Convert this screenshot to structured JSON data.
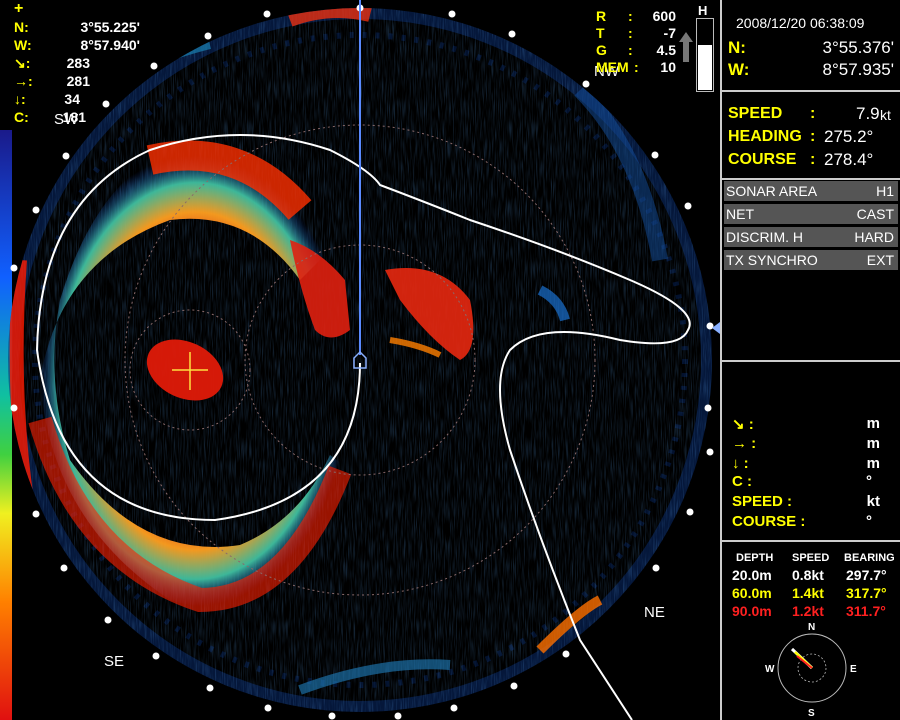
{
  "colors": {
    "accent": "#ffff00",
    "value": "#ffffff",
    "alert": "#ff2020",
    "button_bg": "#555555",
    "ring": "#ffffff"
  },
  "top_left": {
    "cursor_icon": "plus-icon",
    "rows": [
      {
        "key": "N:",
        "value": "3°55.225'"
      },
      {
        "key": "W:",
        "value": "8°57.940'"
      },
      {
        "key": "↘:",
        "value": "283"
      },
      {
        "key": "→:",
        "value": "281"
      },
      {
        "key": "↓:",
        "value": "34"
      },
      {
        "key": "C:",
        "value": "181"
      }
    ]
  },
  "top_mid": {
    "rows": [
      {
        "key": "R",
        "value": "600"
      },
      {
        "key": "T",
        "value": "-7"
      },
      {
        "key": "G",
        "value": "4.5"
      },
      {
        "key": "MEM",
        "value": "10"
      }
    ],
    "gain_label": "H",
    "gain_level": 0.62
  },
  "sonar": {
    "direction_labels": [
      "SW",
      "NW",
      "NE",
      "SE"
    ]
  },
  "panel": {
    "datetime": "2008/12/20 06:38:09",
    "lat_key": "N:",
    "lat": "3°55.376'",
    "lon_key": "W:",
    "lon": "8°57.935'",
    "speed_key": "SPEED",
    "speed": "7.9",
    "speed_unit": "kt",
    "heading_key": "HEADING",
    "heading": "275.2°",
    "course_key": "COURSE",
    "course": "278.4°",
    "colon": ":",
    "settings": [
      {
        "label": "SONAR AREA",
        "value": "H1"
      },
      {
        "label": "NET",
        "value": "CAST"
      },
      {
        "label": "DISCRIM. H",
        "value": "HARD"
      },
      {
        "label": "TX SYNCHRO",
        "value": "EXT"
      }
    ],
    "target": {
      "rows": [
        {
          "key": "↘ :",
          "unit": "m"
        },
        {
          "key": "→ :",
          "unit": "m"
        },
        {
          "key": "↓ :",
          "unit": "m"
        },
        {
          "key": "C :",
          "unit": "°"
        },
        {
          "key": "SPEED    :",
          "unit": "kt"
        },
        {
          "key": "COURSE :",
          "unit": "°"
        }
      ]
    },
    "current": {
      "headers": [
        "DEPTH",
        "SPEED",
        "BEARING"
      ],
      "rows": [
        {
          "depth": "20.0m",
          "speed": "0.8kt",
          "bearing": "297.7°",
          "color": "#ffffff"
        },
        {
          "depth": "60.0m",
          "speed": "1.4kt",
          "bearing": "317.7°",
          "color": "#ffff00"
        },
        {
          "depth": "90.0m",
          "speed": "1.2kt",
          "bearing": "311.7°",
          "color": "#ff2020"
        }
      ]
    },
    "compass": {
      "n": "N",
      "s": "S",
      "e": "E",
      "w": "W"
    }
  }
}
